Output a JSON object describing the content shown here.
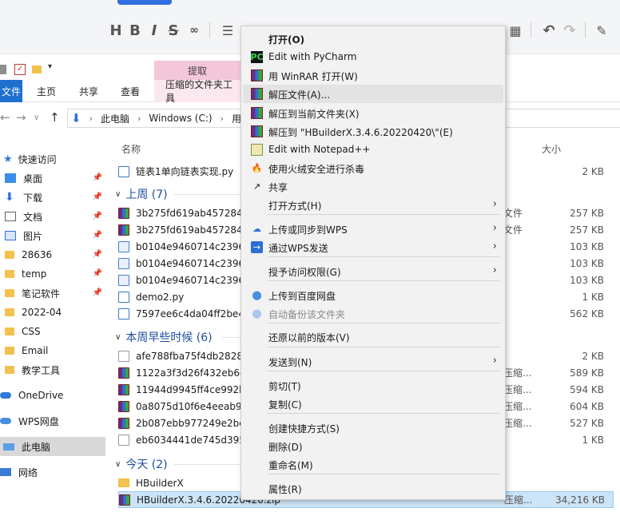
{
  "editor_toolbar": {
    "icons": [
      "H",
      "B",
      "I",
      "S",
      "link",
      "list",
      "table",
      "undo",
      "redo",
      "pen"
    ]
  },
  "ribbon": {
    "contextual_header": "提取",
    "tabs": [
      "文件",
      "主页",
      "共享",
      "查看",
      "压缩的文件夹工具"
    ]
  },
  "address": {
    "crumbs": [
      "此电脑",
      "Windows (C:)",
      "用户"
    ]
  },
  "nav": {
    "quick_access": "快速访问",
    "items": [
      {
        "label": "桌面",
        "pinned": true
      },
      {
        "label": "下载",
        "pinned": true
      },
      {
        "label": "文档",
        "pinned": true
      },
      {
        "label": "图片",
        "pinned": true
      },
      {
        "label": "28636",
        "pinned": true
      },
      {
        "label": "temp",
        "pinned": true
      },
      {
        "label": "笔记软件",
        "pinned": true
      },
      {
        "label": "2022-04",
        "pinned": false
      },
      {
        "label": "CSS",
        "pinned": false
      },
      {
        "label": "Email",
        "pinned": false
      },
      {
        "label": "教学工具",
        "pinned": false
      }
    ],
    "onedrive": "OneDrive",
    "wps": "WPS网盘",
    "thispc": "此电脑",
    "network": "网络"
  },
  "filelist": {
    "col_name": "名称",
    "col_size": "大小",
    "first_row": {
      "name": "链表1单向链表实现.py",
      "size": "2 KB"
    },
    "groups": [
      {
        "title": "上周 (7)",
        "rows": [
          {
            "icon": "rar",
            "name": "3b275fd619ab457284",
            "type": "文件",
            "size": "257 KB"
          },
          {
            "icon": "rar",
            "name": "3b275fd619ab457284",
            "type": "文件",
            "size": "257 KB"
          },
          {
            "icon": "img",
            "name": "b0104e9460714c2396",
            "type": "",
            "size": "103 KB"
          },
          {
            "icon": "img",
            "name": "b0104e9460714c2396",
            "type": "",
            "size": "103 KB"
          },
          {
            "icon": "img",
            "name": "b0104e9460714c2396",
            "type": "",
            "size": "103 KB"
          },
          {
            "icon": "py",
            "name": "demo2.py",
            "type": "",
            "size": "1 KB"
          },
          {
            "icon": "py",
            "name": "7597ee6c4da04ff2be4",
            "type": "",
            "size": "562 KB"
          }
        ]
      },
      {
        "title": "本周早些时候 (6)",
        "rows": [
          {
            "icon": "txt",
            "name": "afe788fba75f4db2828",
            "type": "",
            "size": "2 KB"
          },
          {
            "icon": "rar",
            "name": "1122a3f3d26f432eb6c",
            "type": "压缩...",
            "size": "589 KB"
          },
          {
            "icon": "rar",
            "name": "11944d9945ff4ce992b",
            "type": "压缩...",
            "size": "594 KB"
          },
          {
            "icon": "rar",
            "name": "0a8075d10f6e4eeab9",
            "type": "压缩...",
            "size": "604 KB"
          },
          {
            "icon": "rar",
            "name": "2b087ebb977249e2bc",
            "type": "压缩...",
            "size": "527 KB"
          },
          {
            "icon": "txt",
            "name": "eb6034441de745d395",
            "type": "",
            "size": "1 KB"
          }
        ]
      },
      {
        "title": "今天 (2)",
        "rows": [
          {
            "icon": "folder",
            "name": "HBuilderX",
            "type": "",
            "size": ""
          },
          {
            "icon": "rar",
            "name": "HBuilderX.3.4.6.20220420.zip",
            "type": "压缩...",
            "size": "34,216 KB"
          }
        ]
      }
    ]
  },
  "context_menu": {
    "items": [
      {
        "label": "打开(O)",
        "bold": true
      },
      {
        "label": "Edit with PyCharm"
      },
      {
        "label": "用 WinRAR 打开(W)"
      },
      {
        "label": "解压文件(A)..."
      },
      {
        "label": "解压到当前文件夹(X)"
      },
      {
        "label": "解压到 \"HBuilderX.3.4.6.20220420\\\"(E)"
      },
      {
        "label": "Edit with Notepad++"
      },
      {
        "label": "使用火绒安全进行杀毒"
      },
      {
        "label": "共享"
      },
      {
        "label": "打开方式(H)"
      },
      {
        "label": "上传或同步到WPS"
      },
      {
        "label": "通过WPS发送"
      },
      {
        "label": "授予访问权限(G)"
      },
      {
        "label": "上传到百度网盘"
      },
      {
        "label": "自动备份该文件夹"
      },
      {
        "label": "还原以前的版本(V)"
      },
      {
        "label": "发送到(N)"
      },
      {
        "label": "剪切(T)"
      },
      {
        "label": "复制(C)"
      },
      {
        "label": "创建快捷方式(S)"
      },
      {
        "label": "删除(D)"
      },
      {
        "label": "重命名(M)"
      },
      {
        "label": "属性(R)"
      }
    ]
  }
}
